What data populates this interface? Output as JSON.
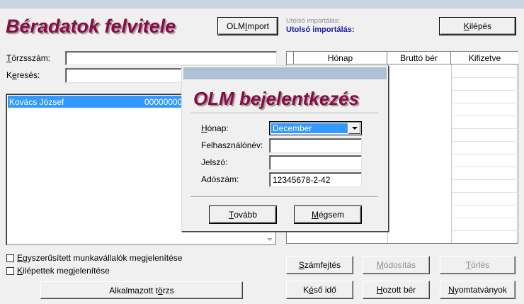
{
  "header": {
    "title": "Béradatok felvitele",
    "olm_import_button": {
      "label": "OLM Import",
      "hotkey_pre": "OLM ",
      "hotkey": "I",
      "hotkey_post": "mport"
    },
    "last_import_label_small": "Utolsó importálás:",
    "last_import_label": "Utolsó importálás:",
    "exit_button": {
      "hotkey": "K",
      "rest": "ilépés"
    }
  },
  "form": {
    "torzsszam_label": {
      "hotkey": "T",
      "rest": "örzsszám:"
    },
    "torzsszam_value": "",
    "kereses_label": {
      "pre": "K",
      "hotkey": "e",
      "rest": "resés:"
    },
    "kereses_value": ""
  },
  "employee_list": {
    "items": [
      {
        "name": "Kovács József",
        "id": "00000000"
      }
    ]
  },
  "grid": {
    "columns": [
      "Hónap",
      "Bruttó bér",
      "Kifizetve"
    ]
  },
  "options": {
    "simplified_checkbox": {
      "hotkey": "E",
      "rest": "gyszerűsített munkavállalók megjelenítése",
      "checked": false
    },
    "left_checkbox": {
      "hotkey": "K",
      "rest": "ilépettek megjelenítése",
      "checked": false
    }
  },
  "bottom_buttons": {
    "alkalmazott_torzs": {
      "pre": "Alkalmazott t",
      "hotkey": "ö",
      "rest": "rzs"
    },
    "szamfejtes": {
      "hotkey": "S",
      "rest": "zámfejtés"
    },
    "modositas": {
      "hotkey": "M",
      "rest": "ódosítás"
    },
    "torles": {
      "hotkey": "T",
      "rest": "örlés"
    },
    "keso_ido": {
      "pre": "K",
      "hotkey": "é",
      "rest": "ső idő"
    },
    "hozott_ber": {
      "hotkey": "H",
      "rest": "ozott bér"
    },
    "nyomtatvanyok": {
      "hotkey": "N",
      "rest": "yomtatványok"
    }
  },
  "dialog": {
    "title": "OLM bejelentkezés",
    "honap_label": {
      "hotkey": "H",
      "rest": "ónap:"
    },
    "honap_value": "December",
    "user_label": "Felhasználónév:",
    "user_value": "",
    "password_label": "Jelszó:",
    "password_value": "",
    "tax_label": "Adószám:",
    "tax_value": "12345678-2-42",
    "next_button": {
      "hotkey": "T",
      "rest": "ovább"
    },
    "cancel_button": {
      "hotkey": "M",
      "rest": "égsem"
    }
  },
  "colors": {
    "title_color": "#8a0a43",
    "selection": "#3399ff",
    "link_blue": "#1c1c9e"
  }
}
